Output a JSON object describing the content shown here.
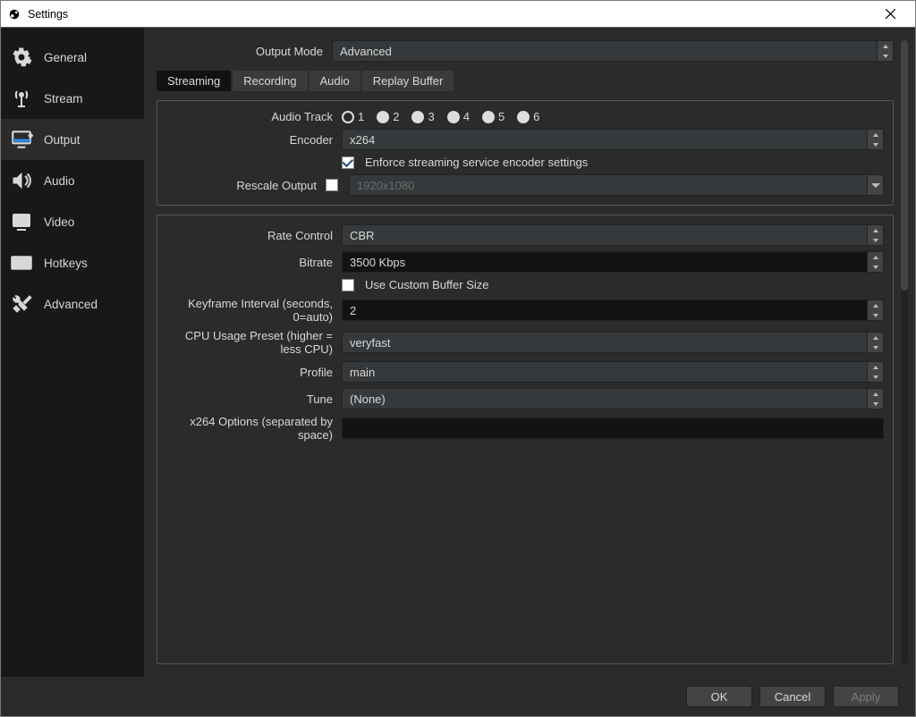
{
  "titlebar": {
    "title": "Settings"
  },
  "sidebar": {
    "items": [
      {
        "label": "General"
      },
      {
        "label": "Stream"
      },
      {
        "label": "Output"
      },
      {
        "label": "Audio"
      },
      {
        "label": "Video"
      },
      {
        "label": "Hotkeys"
      },
      {
        "label": "Advanced"
      }
    ],
    "selected_index": 2
  },
  "output_mode": {
    "label": "Output Mode",
    "value": "Advanced"
  },
  "tabs": {
    "items": [
      "Streaming",
      "Recording",
      "Audio",
      "Replay Buffer"
    ],
    "active_index": 0
  },
  "stream_top": {
    "audio_track_label": "Audio Track",
    "tracks": [
      "1",
      "2",
      "3",
      "4",
      "5",
      "6"
    ],
    "selected_track_index": 0,
    "encoder_label": "Encoder",
    "encoder_value": "x264",
    "enforce_label": "Enforce streaming service encoder settings",
    "enforce_checked": true,
    "rescale_label": "Rescale Output",
    "rescale_checked": false,
    "rescale_value": "1920x1080"
  },
  "enc": {
    "rate_control_label": "Rate Control",
    "rate_control_value": "CBR",
    "bitrate_label": "Bitrate",
    "bitrate_value": "3500 Kbps",
    "custom_buf_label": "Use Custom Buffer Size",
    "custom_buf_checked": false,
    "keyframe_label": "Keyframe Interval (seconds, 0=auto)",
    "keyframe_value": "2",
    "cpu_label": "CPU Usage Preset (higher = less CPU)",
    "cpu_value": "veryfast",
    "profile_label": "Profile",
    "profile_value": "main",
    "tune_label": "Tune",
    "tune_value": "(None)",
    "x264opt_label": "x264 Options (separated by space)",
    "x264opt_value": ""
  },
  "footer": {
    "ok": "OK",
    "cancel": "Cancel",
    "apply": "Apply"
  }
}
